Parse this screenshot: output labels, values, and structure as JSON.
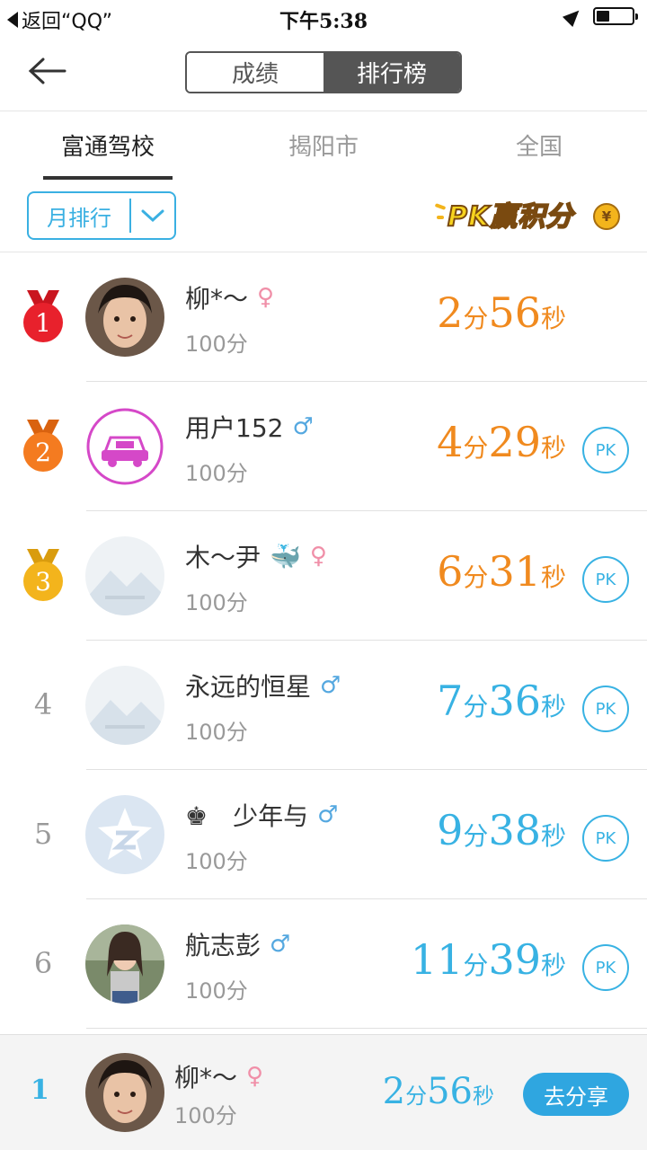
{
  "status_bar": {
    "back_label": "返回“QQ”",
    "time": "下午5:38"
  },
  "nav": {
    "segments": [
      "成绩",
      "排行榜"
    ],
    "active_segment": "排行榜"
  },
  "tabs": [
    "富通驾校",
    "揭阳市",
    "全国"
  ],
  "active_tab": "富通驾校",
  "filter": {
    "label": "月排行"
  },
  "pk_banner": {
    "text": "PK赢积分",
    "coin": "¥"
  },
  "ranking": [
    {
      "rank": "1",
      "name": "柳*～",
      "gender": "♀",
      "score": "100分",
      "min": "2",
      "min_unit": "分",
      "sec": "56",
      "sec_unit": "秒",
      "color": "orange",
      "pk": "",
      "avatar": "photo-woman"
    },
    {
      "rank": "2",
      "name": "用户152",
      "gender": "♂",
      "score": "100分",
      "min": "4",
      "min_unit": "分",
      "sec": "29",
      "sec_unit": "秒",
      "color": "orange",
      "pk": "PK",
      "avatar": "car-icon"
    },
    {
      "rank": "3",
      "name": "木～尹",
      "gender": "♀",
      "score": "100分",
      "min": "6",
      "min_unit": "分",
      "sec": "31",
      "sec_unit": "秒",
      "color": "orange",
      "pk": "PK",
      "avatar": "placeholder-mountain"
    },
    {
      "rank": "4",
      "name": "永远的恒星",
      "gender": "♂",
      "score": "100分",
      "min": "7",
      "min_unit": "分",
      "sec": "36",
      "sec_unit": "秒",
      "color": "blue",
      "pk": "PK",
      "avatar": "placeholder-mountain"
    },
    {
      "rank": "5",
      "name": "♚　少年与",
      "gender": "♂",
      "score": "100分",
      "min": "9",
      "min_unit": "分",
      "sec": "38",
      "sec_unit": "秒",
      "color": "blue",
      "pk": "PK",
      "avatar": "qzone-icon"
    },
    {
      "rank": "6",
      "name": "航志彭",
      "gender": "♂",
      "score": "100分",
      "min": "11",
      "min_unit": "分",
      "sec": "39",
      "sec_unit": "秒",
      "color": "blue",
      "pk": "PK",
      "avatar": "photo-girl"
    }
  ],
  "my_rank": {
    "rank": "1",
    "name": "柳*～",
    "gender": "♀",
    "score": "100分",
    "min": "2",
    "min_unit": "分",
    "sec": "56",
    "sec_unit": "秒",
    "share_label": "去分享"
  },
  "colors": {
    "accent": "#38b2e3",
    "orange": "#f08a1f",
    "medal_red": "#e8212c",
    "medal_orange": "#f47b20",
    "medal_gold": "#f3b41c"
  }
}
